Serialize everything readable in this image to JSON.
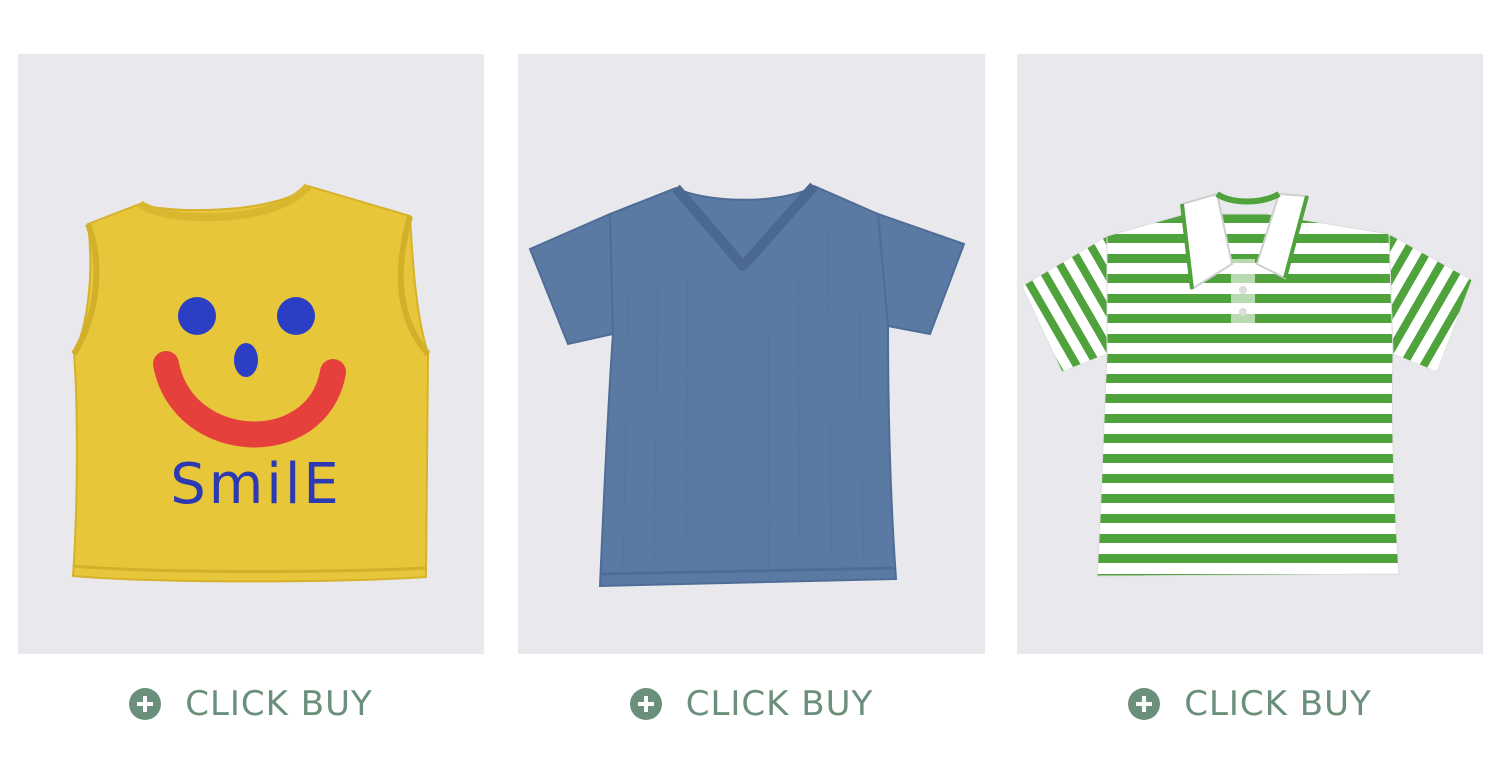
{
  "products": [
    {
      "id": "p1",
      "image_desc_icon": "yellow-smile-tank-top",
      "print_text": "SmilE",
      "button_label": "CLICK BUY",
      "colors": {
        "garment": "#e8c63a",
        "eye": "#2a3fc4",
        "mouth": "#e5403c",
        "text": "#2b3ab3"
      }
    },
    {
      "id": "p2",
      "image_desc_icon": "blue-vneck-tshirt",
      "button_label": "CLICK BUY",
      "colors": {
        "garment": "#5b7aa3"
      }
    },
    {
      "id": "p3",
      "image_desc_icon": "green-striped-polo",
      "button_label": "CLICK BUY",
      "colors": {
        "stripe": "#4fa23c",
        "collar": "#ffffff"
      }
    }
  ],
  "theme": {
    "background": "#ffffff",
    "photo_background": "#e9e9ed",
    "accent": "#6a8f7a"
  }
}
